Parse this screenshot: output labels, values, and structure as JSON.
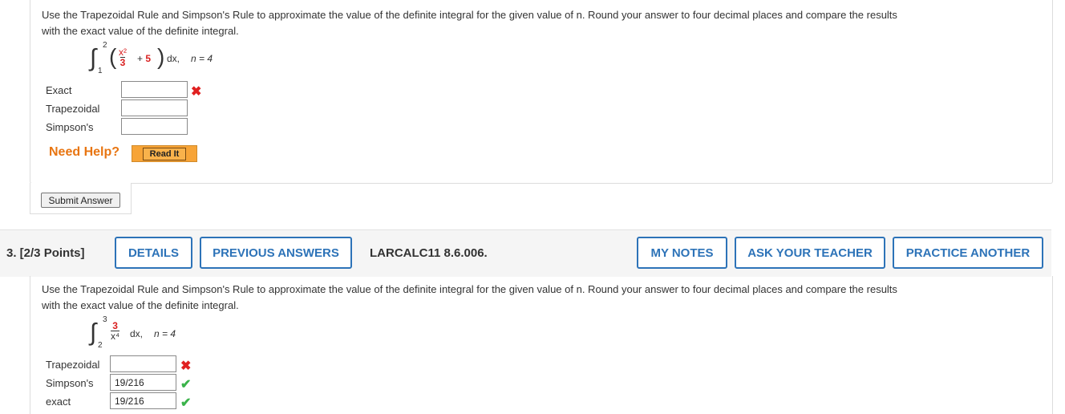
{
  "q2": {
    "prompt_line1": "Use the Trapezoidal Rule and Simpson's Rule to approximate the value of the definite integral for the given value of n. Round your answer to four decimal places and compare the results",
    "prompt_line2": "with the exact value of the definite integral.",
    "integral": {
      "upper": "2",
      "lower": "1",
      "num": "x²",
      "den": "3",
      "plus_term": "+ 5",
      "dx": "dx,",
      "n_text": "n = 4"
    },
    "rows": [
      {
        "label": "Exact",
        "value": "",
        "mark": "x"
      },
      {
        "label": "Trapezoidal",
        "value": "",
        "mark": ""
      },
      {
        "label": "Simpson's",
        "value": "",
        "mark": ""
      }
    ],
    "need_help": "Need Help?",
    "read_it": "Read It",
    "submit": "Submit Answer"
  },
  "q3": {
    "label": "3.  [2/3 Points]",
    "buttons": {
      "details": "DETAILS",
      "previous_answers": "PREVIOUS ANSWERS",
      "my_notes": "MY NOTES",
      "ask_teacher": "ASK YOUR TEACHER",
      "practice_another": "PRACTICE ANOTHER"
    },
    "reference": "LARCALC11 8.6.006.",
    "prompt_line1": "Use the Trapezoidal Rule and Simpson's Rule to approximate the value of the definite integral for the given value of n. Round your answer to four decimal places and compare the results",
    "prompt_line2": "with the exact value of the definite integral.",
    "integral": {
      "upper": "3",
      "lower": "2",
      "num": "3",
      "den": "x⁴",
      "dx": "dx,",
      "n_text": "n = 4"
    },
    "rows": [
      {
        "label": "Trapezoidal",
        "value": "",
        "mark": "x"
      },
      {
        "label": "Simpson's",
        "value": "19/216",
        "mark": "check"
      },
      {
        "label": "exact",
        "value": "19/216",
        "mark": "check"
      }
    ]
  },
  "colors": {
    "accent": "#2d73b8",
    "help": "#e87511",
    "error": "#e02020",
    "ok": "#3ab34a"
  }
}
